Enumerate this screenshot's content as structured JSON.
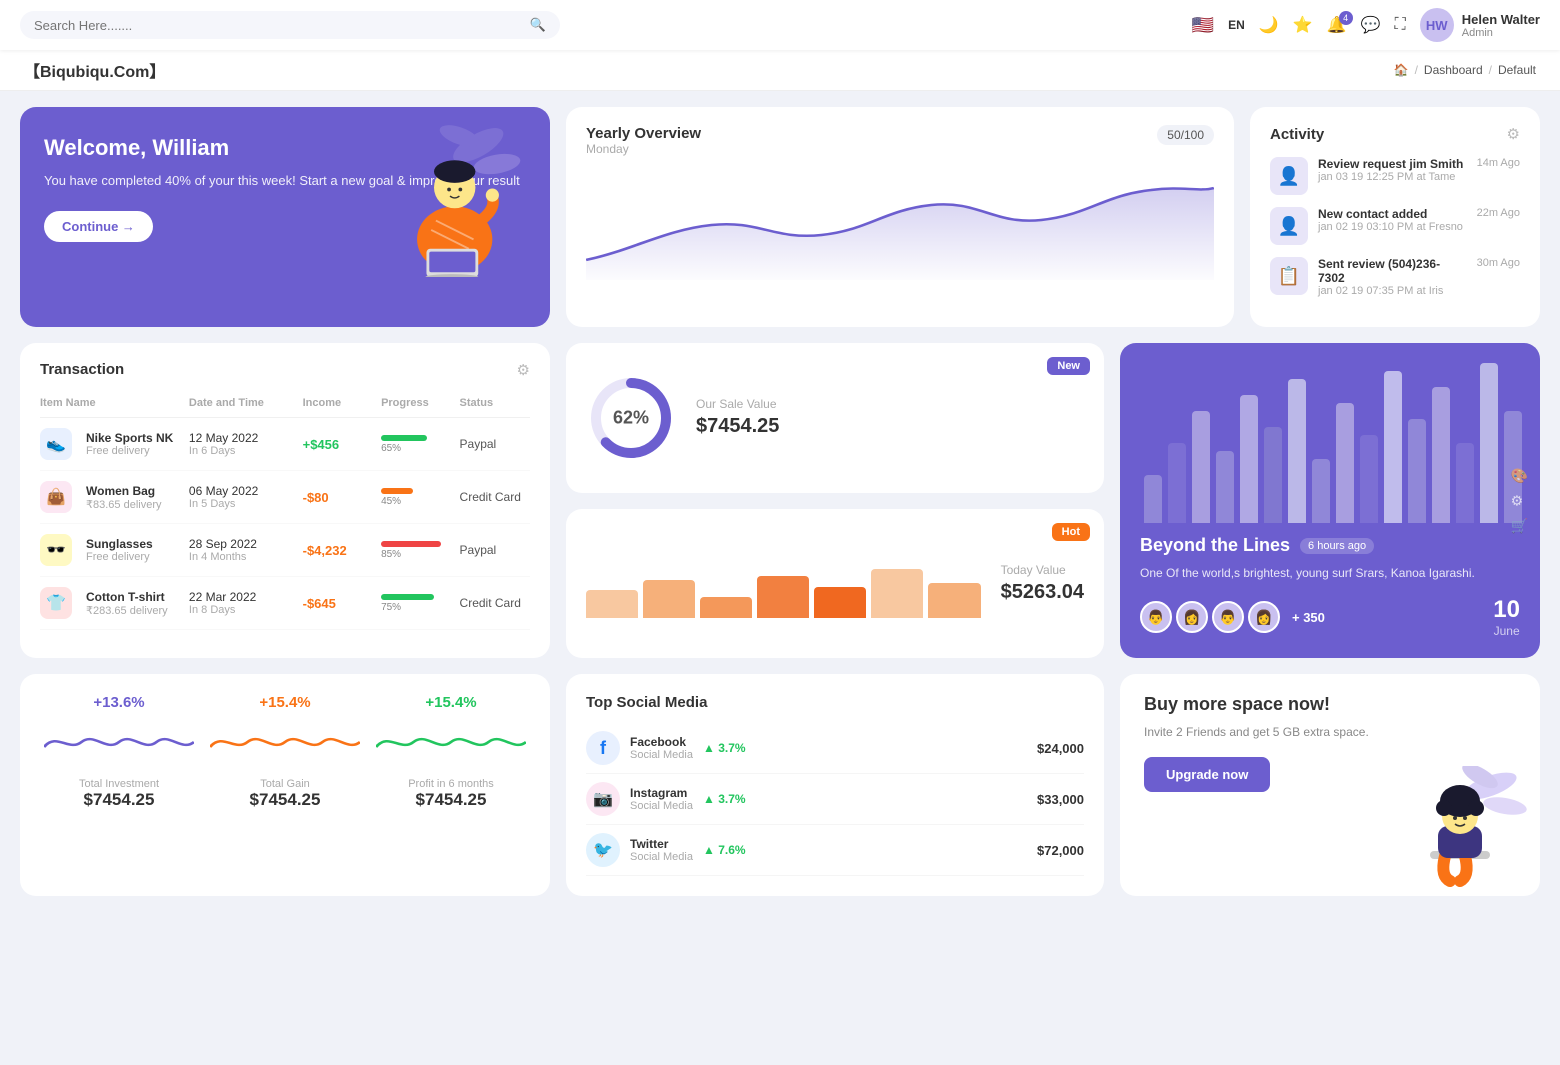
{
  "topnav": {
    "search_placeholder": "Search Here.......",
    "lang": "EN",
    "username": "Helen Walter",
    "user_role": "Admin",
    "notif_count": "4"
  },
  "breadcrumb": {
    "brand": "【Biqubiqu.Com】",
    "home": "⌂",
    "path1": "Dashboard",
    "path2": "Default"
  },
  "welcome": {
    "title": "Welcome, William",
    "subtitle": "You have completed 40% of your this week! Start a new goal & improve your result",
    "button": "Continue →"
  },
  "yearly": {
    "title": "Yearly Overview",
    "badge": "50/100",
    "subtitle": "Monday"
  },
  "activity": {
    "title": "Activity",
    "items": [
      {
        "title": "Review request jim Smith",
        "subtitle": "jan 03 19 12:25 PM at Tame",
        "time": "14m Ago",
        "emoji": "👤"
      },
      {
        "title": "New contact added",
        "subtitle": "jan 02 19 03:10 PM at Fresno",
        "time": "22m Ago",
        "emoji": "👤"
      },
      {
        "title": "Sent review (504)236-7302",
        "subtitle": "jan 02 19 07:35 PM at Iris",
        "time": "30m Ago",
        "emoji": "📋"
      }
    ]
  },
  "transaction": {
    "title": "Transaction",
    "headers": [
      "Item Name",
      "Date and Time",
      "Income",
      "Progress",
      "Status"
    ],
    "rows": [
      {
        "icon": "👟",
        "icon_bg": "#e8f0fe",
        "name": "Nike Sports NK",
        "sub": "Free delivery",
        "date": "12 May 2022",
        "date_sub": "In 6 Days",
        "income": "+$456",
        "income_type": "pos",
        "progress": 65,
        "progress_color": "#22c55e",
        "status": "Paypal"
      },
      {
        "icon": "👜",
        "icon_bg": "#fce7f3",
        "name": "Women Bag",
        "sub": "₹83.65 delivery",
        "date": "06 May 2022",
        "date_sub": "In 5 Days",
        "income": "-$80",
        "income_type": "neg",
        "progress": 45,
        "progress_color": "#f97316",
        "status": "Credit Card"
      },
      {
        "icon": "🕶️",
        "icon_bg": "#fef9c3",
        "name": "Sunglasses",
        "sub": "Free delivery",
        "date": "28 Sep 2022",
        "date_sub": "In 4 Months",
        "income": "-$4,232",
        "income_type": "neg",
        "progress": 85,
        "progress_color": "#ef4444",
        "status": "Paypal"
      },
      {
        "icon": "👕",
        "icon_bg": "#fee2e2",
        "name": "Cotton T-shirt",
        "sub": "₹283.65 delivery",
        "date": "22 Mar 2022",
        "date_sub": "In 8 Days",
        "income": "-$645",
        "income_type": "neg",
        "progress": 75,
        "progress_color": "#22c55e",
        "status": "Credit Card"
      }
    ]
  },
  "sale_value": {
    "badge": "New",
    "percent": "62%",
    "label": "Our Sale Value",
    "value": "$7454.25"
  },
  "today_value": {
    "badge": "Hot",
    "label": "Today Value",
    "value": "$5263.04",
    "bars": [
      40,
      55,
      30,
      60,
      45,
      70,
      50
    ]
  },
  "beyond": {
    "title": "Beyond the Lines",
    "time": "6 hours ago",
    "desc": "One Of the world,s brightest, young surf Srars, Kanoa Igarashi.",
    "plus_count": "+ 350",
    "date_num": "10",
    "date_month": "June",
    "bars": [
      30,
      50,
      70,
      45,
      80,
      60,
      90,
      40,
      75,
      55,
      95,
      65,
      85,
      50,
      100,
      70
    ]
  },
  "stats": [
    {
      "pct": "+13.6%",
      "pct_color": "#6c5ecf",
      "label": "Total Investment",
      "value": "$7454.25",
      "wave_color": "#6c5ecf"
    },
    {
      "pct": "+15.4%",
      "pct_color": "#f97316",
      "label": "Total Gain",
      "value": "$7454.25",
      "wave_color": "#f97316"
    },
    {
      "pct": "+15.4%",
      "pct_color": "#22c55e",
      "label": "Profit in 6 months",
      "value": "$7454.25",
      "wave_color": "#22c55e"
    }
  ],
  "social": {
    "title": "Top Social Media",
    "items": [
      {
        "name": "Facebook",
        "sub": "Social Media",
        "pct": "3.7%",
        "amount": "$24,000",
        "icon": "f",
        "icon_bg": "#e8f0fe",
        "icon_color": "#1877f2"
      },
      {
        "name": "Instagram",
        "sub": "Social Media",
        "pct": "3.7%",
        "amount": "$33,000",
        "icon": "📷",
        "icon_bg": "#fce7f3",
        "icon_color": "#e1306c"
      },
      {
        "name": "Twitter",
        "sub": "Social Media",
        "pct": "7.6%",
        "amount": "$72,000",
        "icon": "t",
        "icon_bg": "#e0f2fe",
        "icon_color": "#1da1f2"
      }
    ]
  },
  "space": {
    "title": "Buy more space now!",
    "desc": "Invite 2 Friends and get 5 GB extra space.",
    "button": "Upgrade now"
  }
}
